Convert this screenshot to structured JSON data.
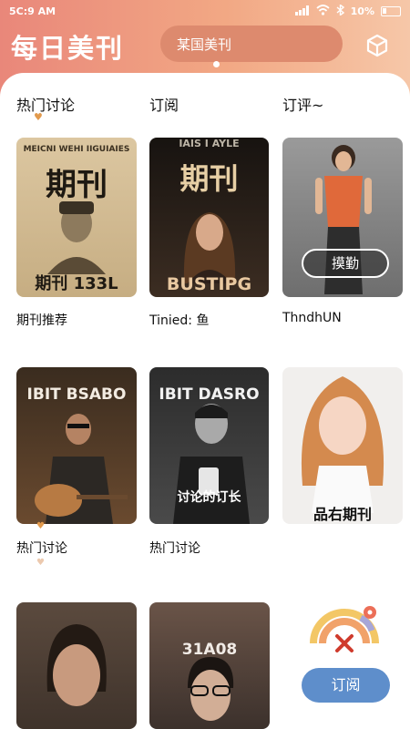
{
  "status_bar": {
    "time": "5C:9 AM",
    "battery": "10%"
  },
  "header": {
    "title": "每日美刊",
    "search_text": "某国美刊"
  },
  "tabs": [
    "热门讨论",
    "订阅",
    "订评~"
  ],
  "cards": [
    {
      "caption": "期刊推荐",
      "cover_top": "MEICNI  WEHI  IIGUIAIES",
      "cover_title": "期刊",
      "cover_bottom": "期刊 133L"
    },
    {
      "caption": "Tinied: 鱼",
      "cover_top": "IAIS  I  AYLE",
      "cover_title": "期刊",
      "cover_bottom": "BUSTIPG"
    },
    {
      "caption": "ThndhUN",
      "cover_button": "摸勤"
    },
    {
      "caption": "热门讨论",
      "cover_title": "IBIT  BSABO"
    },
    {
      "caption": "热门讨论",
      "cover_title": "IBIT  DASRO",
      "cover_subtitle": "讨论的订长"
    },
    {
      "caption": "",
      "cover_bottom": "品右期刊"
    },
    {
      "caption": ""
    },
    {
      "caption": "",
      "cover_title": "31A08"
    }
  ],
  "fab": {
    "label": "订阅"
  },
  "colors": {
    "header_start": "#e9877a",
    "header_end": "#f6c7a8",
    "fab": "#5e8ecb",
    "marker": "#e29a4d"
  }
}
